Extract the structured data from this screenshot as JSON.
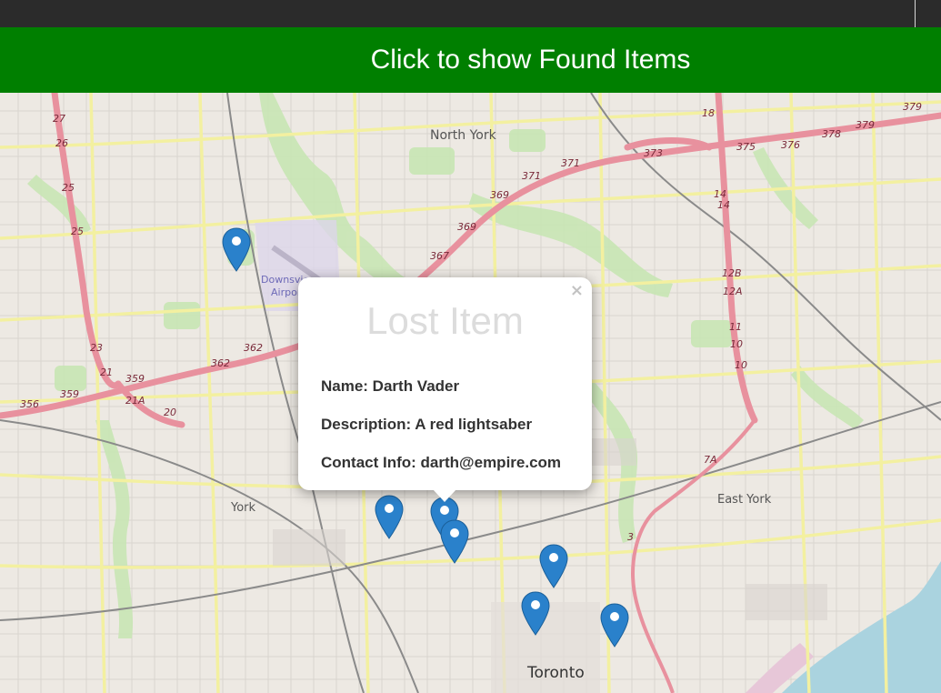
{
  "banner": {
    "label": "Click to show Found Items",
    "color": "#007f00"
  },
  "popup": {
    "title": "Lost Item",
    "close_glyph": "×",
    "name_line": "Name: Darth Vader",
    "description_line": "Description: A red lightsaber",
    "contact_line": "Contact Info: darth@empire.com"
  },
  "map": {
    "places": {
      "north_york": "North York",
      "downsview_1": "Downsview",
      "downsview_2": "Airport",
      "york": "York",
      "east_york": "East York",
      "toronto": "Toronto"
    },
    "highway_labels": [
      "27",
      "26",
      "25",
      "25",
      "23",
      "21",
      "21A",
      "20",
      "356",
      "359",
      "359",
      "362",
      "362",
      "367",
      "369",
      "369",
      "371",
      "371",
      "373",
      "375",
      "376",
      "378",
      "379",
      "379",
      "18",
      "14",
      "14",
      "12B",
      "12A",
      "11",
      "10",
      "10",
      "7A",
      "3"
    ],
    "marker_color": "#2a81cb",
    "marker_count": 8
  }
}
